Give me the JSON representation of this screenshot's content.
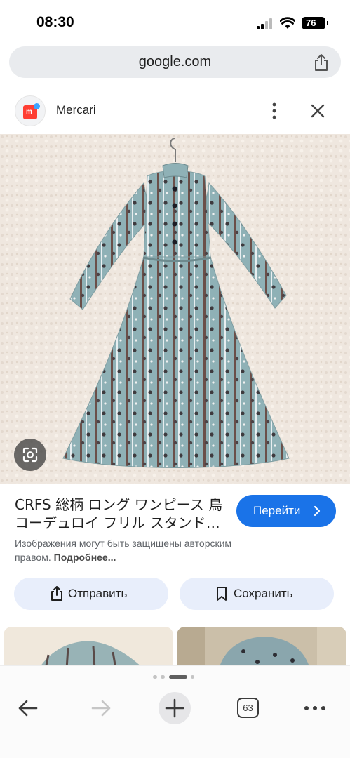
{
  "status_bar": {
    "time": "08:30",
    "battery": "76"
  },
  "address_bar": {
    "url": "google.com"
  },
  "header": {
    "site_name": "Mercari",
    "logo_letter": "m"
  },
  "result": {
    "title": "CRFS 総柄 ロング ワンピース 鳥 コーデュロイ フリル スタンド…",
    "visit_label": "Перейти",
    "copyright_text": "Изображения могут быть защищены авторским правом.",
    "more_link": "Подробнее..."
  },
  "actions": {
    "send_label": "Отправить",
    "save_label": "Сохранить"
  },
  "toolbar": {
    "tab_count": "63"
  },
  "colors": {
    "accent": "#1a73e8",
    "dress": "#8fb1b6",
    "carpet": "#efe7df"
  }
}
